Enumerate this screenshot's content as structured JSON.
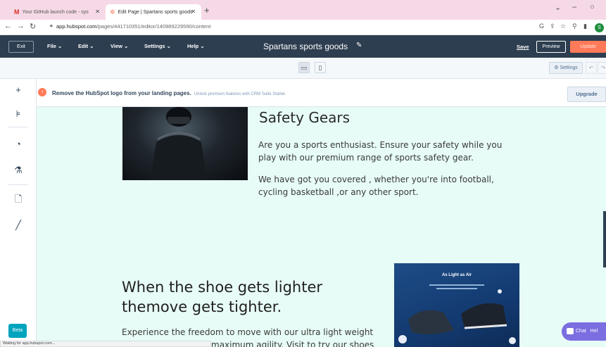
{
  "browser": {
    "tabs": [
      {
        "title": "Your GitHub launch code - sys"
      },
      {
        "title": "Edit Page | Spartans sports goods"
      }
    ],
    "url_host": "app.hubspot.com",
    "url_path": "/pages/441710351/editor/140989229590/content",
    "profile_initial": "S",
    "status_text": "Waiting for app.hubspot.com..."
  },
  "editor": {
    "exit_label": "Exit",
    "menus": [
      "File",
      "Edit",
      "View",
      "Settings",
      "Help"
    ],
    "page_title": "Spartans sports goods",
    "save_label": "Save",
    "preview_label": "Preview",
    "update_label": "Update",
    "settings_label": "Settings",
    "beta_label": "Beta"
  },
  "banner": {
    "text": "Remove the HubSpot logo from your landing pages.",
    "subtext": "Unlock premium features with CRM Suite Starter.",
    "upgrade_label": "Upgrade"
  },
  "content": {
    "section1_heading": "Safety Gears",
    "section1_p1_line1": "Are you a sports enthusiast. Ensure your safety while you",
    "section1_p1_line2": "play with our premium range of sports safety gear.",
    "section1_p2_line1": "We have got you covered , whether you're into football,",
    "section1_p2_line2": "cycling basketball ,or any other sport.",
    "section2_heading_line1": "When the shoe gets lighter",
    "section2_heading_line2": "themove gets tighter.",
    "section2_p_line1": "Experience the freedom to move with our ultra light weight",
    "section2_p_line2": "maximum agility. Visit to try our shoes",
    "image2_caption": "As Light as Air"
  },
  "chat": {
    "label": "Chat",
    "help": "Hel"
  },
  "colors": {
    "hubspot_dark": "#2d3e50",
    "accent": "#ff7a59",
    "canvas": "#e7fcf6"
  }
}
